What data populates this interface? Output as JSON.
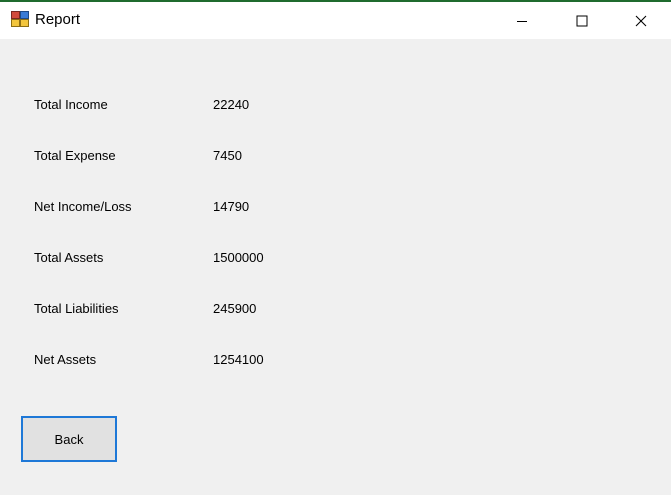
{
  "window": {
    "title": "Report",
    "icon": "report-app-icon",
    "controls": {
      "minimize": "minimize-icon",
      "maximize": "maximize-icon",
      "close": "close-icon"
    }
  },
  "report": {
    "rows": [
      {
        "label": "Total Income",
        "value": "22240"
      },
      {
        "label": "Total Expense",
        "value": "7450"
      },
      {
        "label": "Net Income/Loss",
        "value": "14790"
      },
      {
        "label": "Total Assets",
        "value": "1500000"
      },
      {
        "label": "Total Liabilities",
        "value": "245900"
      },
      {
        "label": "Net Assets",
        "value": "1254100"
      }
    ]
  },
  "actions": {
    "back_label": "Back"
  },
  "colors": {
    "background": "#f0f0f0",
    "title_bar": "#ffffff",
    "focus_border": "#1e78d7",
    "button_face": "#e1e1e1"
  }
}
